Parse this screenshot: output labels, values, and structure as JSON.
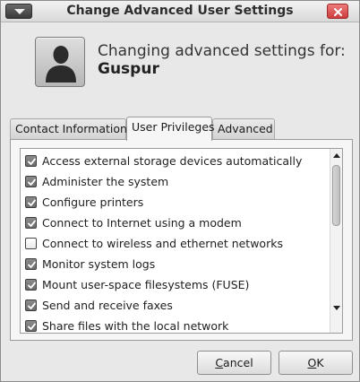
{
  "window": {
    "title": "Change Advanced User Settings"
  },
  "header": {
    "heading": "Changing advanced settings for:",
    "username": "Guspur"
  },
  "tabs": [
    {
      "label": "Contact Information",
      "active": false
    },
    {
      "label": "User Privileges",
      "active": true
    },
    {
      "label": "Advanced",
      "active": false
    }
  ],
  "privileges": [
    {
      "label": "Access external storage devices automatically",
      "checked": true
    },
    {
      "label": "Administer the system",
      "checked": true
    },
    {
      "label": "Configure printers",
      "checked": true
    },
    {
      "label": "Connect to Internet using a modem",
      "checked": true
    },
    {
      "label": "Connect to wireless and ethernet networks",
      "checked": false
    },
    {
      "label": "Monitor system logs",
      "checked": true
    },
    {
      "label": "Mount user-space filesystems (FUSE)",
      "checked": true
    },
    {
      "label": "Send and receive faxes",
      "checked": true
    },
    {
      "label": "Share files with the local network",
      "checked": true
    }
  ],
  "buttons": {
    "cancel_prefix": "",
    "cancel_mnemonic": "C",
    "cancel_rest": "ancel",
    "ok_prefix": "",
    "ok_mnemonic": "O",
    "ok_rest": "K"
  },
  "icons": {
    "window_menu": "chevron-down-icon",
    "close": "close-icon",
    "avatar": "user-silhouette-icon",
    "check": "check-icon",
    "scroll_up": "arrow-up-icon",
    "scroll_down": "arrow-down-icon"
  },
  "colors": {
    "close_button": "#cc3d3d",
    "checkbox_checked": "#7a7a7a"
  }
}
